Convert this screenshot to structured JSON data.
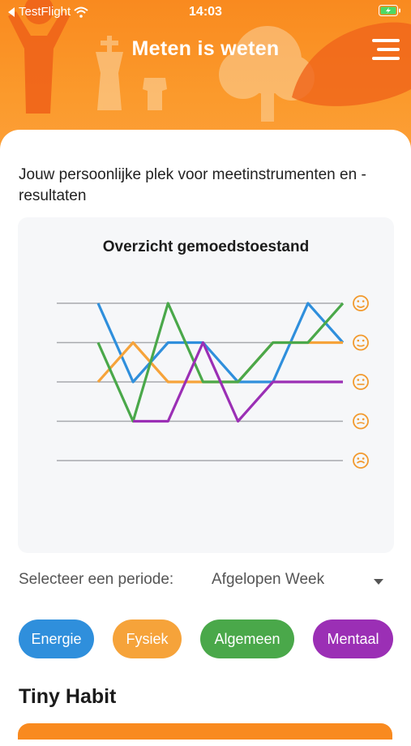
{
  "status_bar": {
    "carrier": "TestFlight",
    "time": "14:03"
  },
  "header": {
    "title": "Meten is weten",
    "menu_icon": "hamburger-menu-icon",
    "accent": "#f98a1f"
  },
  "intro_text": "Jouw persoonlijke plek voor meetinstrumenten en -resultaten",
  "chart_data": {
    "type": "line",
    "title": "Overzicht gemoedstoestand",
    "ylim": [
      1,
      5
    ],
    "y_levels_icons": [
      "very-happy-face-icon",
      "happy-face-icon",
      "neutral-face-icon",
      "sad-face-icon",
      "very-sad-face-icon"
    ],
    "x": [
      1,
      2,
      3,
      4,
      5,
      6,
      7,
      8
    ],
    "grid": true,
    "series": [
      {
        "name": "Energie",
        "color": "#2f8fdc",
        "values": [
          5,
          3,
          4,
          4,
          3,
          3,
          5,
          4
        ]
      },
      {
        "name": "Fysiek",
        "color": "#f6a33a",
        "values": [
          3,
          4,
          3,
          3,
          3,
          4,
          4,
          4
        ]
      },
      {
        "name": "Algemeen",
        "color": "#4aa84a",
        "values": [
          4,
          2,
          5,
          3,
          3,
          4,
          4,
          5
        ]
      },
      {
        "name": "Mentaal",
        "color": "#9b2fb5",
        "values": [
          null,
          2,
          2,
          4,
          2,
          3,
          3,
          3
        ]
      }
    ]
  },
  "period": {
    "label": "Selecteer een periode:",
    "value": "Afgelopen Week"
  },
  "filters": [
    {
      "label": "Energie",
      "color": "#2f8fdc"
    },
    {
      "label": "Fysiek",
      "color": "#f6a33a"
    },
    {
      "label": "Algemeen",
      "color": "#4aa84a"
    },
    {
      "label": "Mentaal",
      "color": "#9b2fb5"
    }
  ],
  "section_title": "Tiny Habit"
}
